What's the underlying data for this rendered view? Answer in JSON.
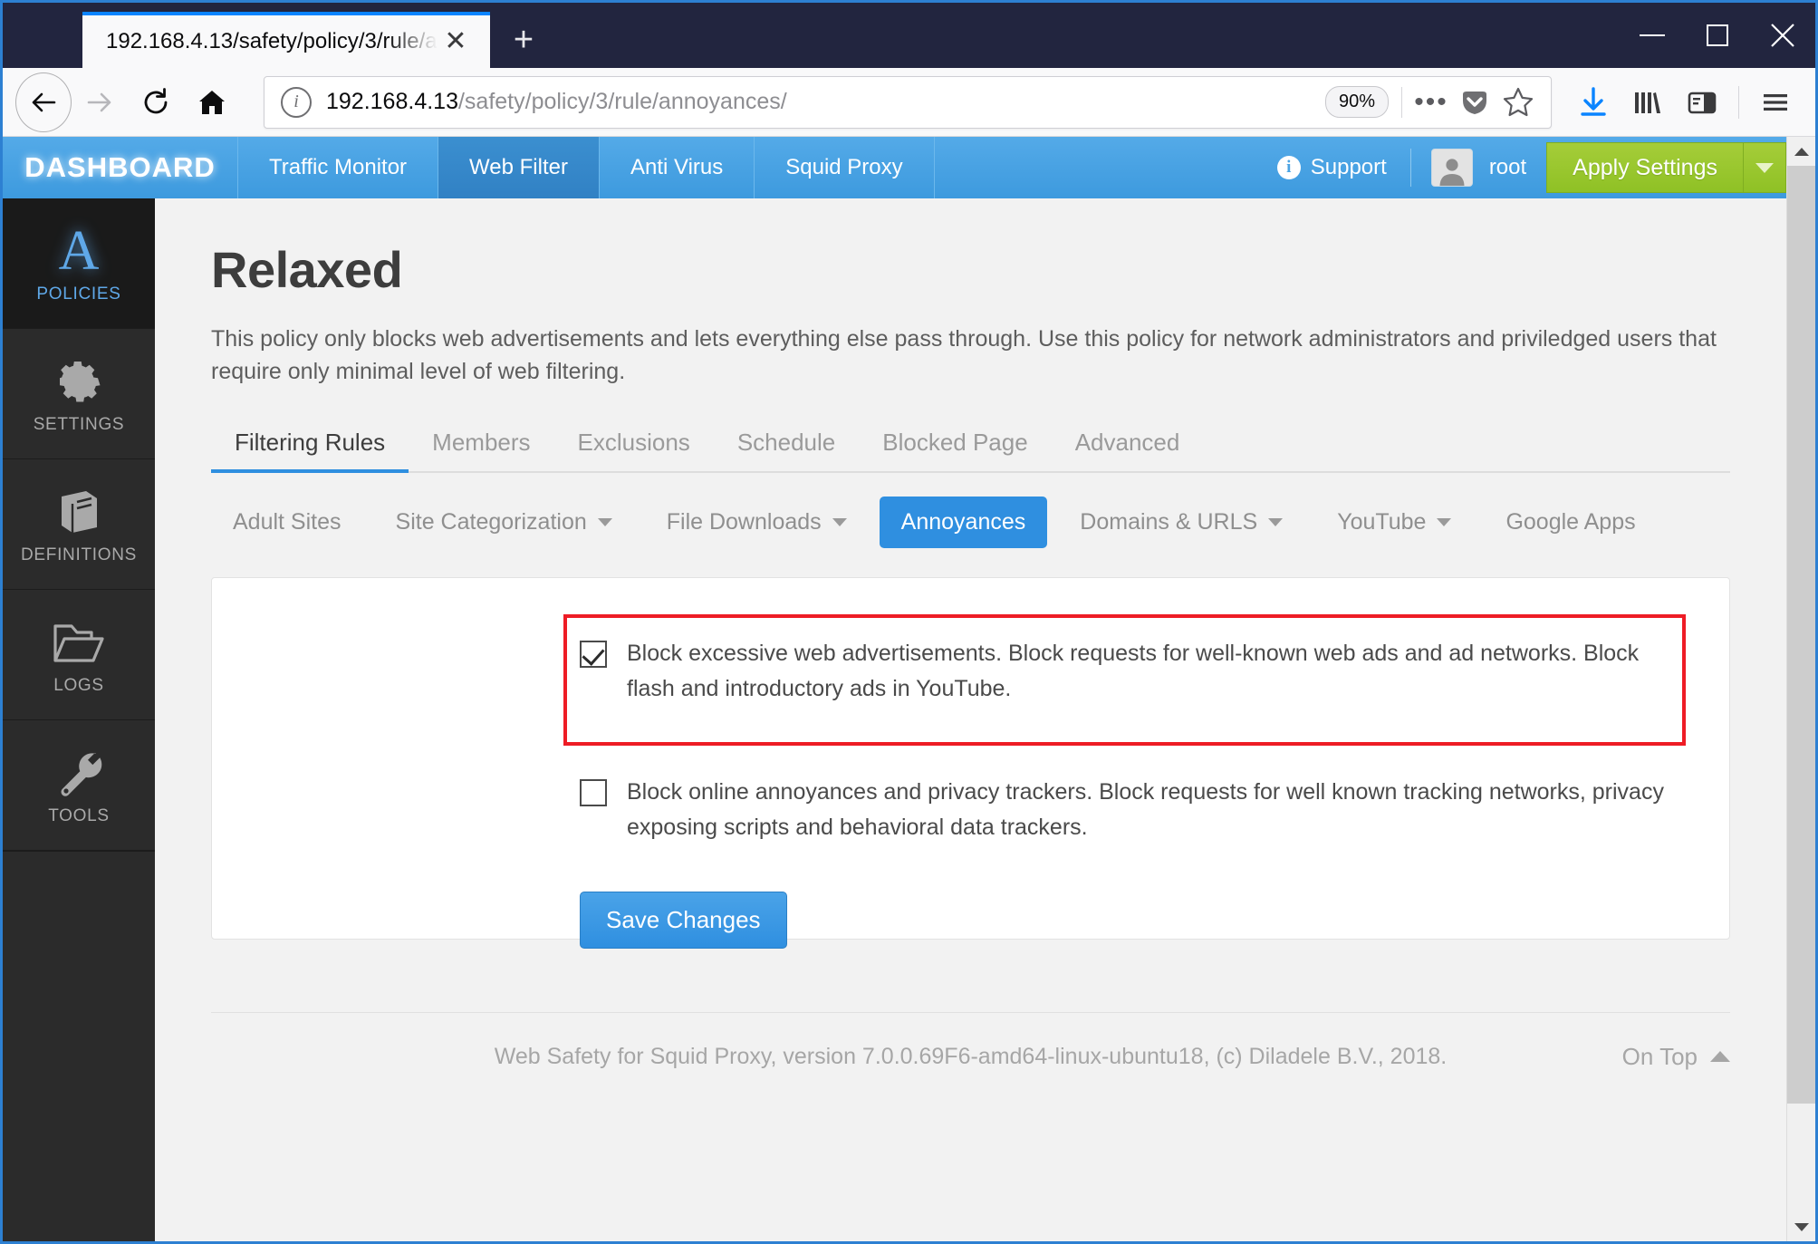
{
  "browser": {
    "tab": {
      "title": "192.168.4.13/safety/policy/3/rule/a",
      "close_label": "✕"
    },
    "new_tab_label": "+",
    "window_controls": {
      "minimize": "─",
      "maximize": "",
      "close": "✕"
    },
    "nav": {
      "back": "back-arrow",
      "forward": "forward-arrow",
      "reload": "reload",
      "home": "home"
    },
    "url": {
      "host": "192.168.4.13",
      "path": "/safety/policy/3/rule/annoyances/",
      "full": "192.168.4.13/safety/policy/3/rule/annoyances/",
      "zoom": "90%",
      "info_icon": "i"
    },
    "toolbar_icons": [
      "page-actions-icon",
      "pocket-icon",
      "bookmark-star-icon",
      "download-icon",
      "library-icon",
      "sidebar-icon",
      "menu-icon"
    ]
  },
  "appnav": {
    "brand": "DASHBOARD",
    "items": [
      {
        "label": "Traffic Monitor",
        "active": false
      },
      {
        "label": "Web Filter",
        "active": true
      },
      {
        "label": "Anti Virus",
        "active": false
      },
      {
        "label": "Squid Proxy",
        "active": false
      }
    ],
    "support_label": "Support",
    "user": "root",
    "apply_label": "Apply Settings"
  },
  "sidebar": {
    "items": [
      {
        "label": "POLICIES",
        "icon": "letter-a-icon",
        "active": true
      },
      {
        "label": "SETTINGS",
        "icon": "gear-icon",
        "active": false
      },
      {
        "label": "DEFINITIONS",
        "icon": "book-icon",
        "active": false
      },
      {
        "label": "LOGS",
        "icon": "folder-icon",
        "active": false
      },
      {
        "label": "TOOLS",
        "icon": "wrench-icon",
        "active": false
      }
    ]
  },
  "main": {
    "title": "Relaxed",
    "description": "This policy only blocks web advertisements and lets everything else pass through. Use this policy for network administrators and priviledged users that require only minimal level of web filtering.",
    "tabs": [
      {
        "label": "Filtering Rules",
        "active": true
      },
      {
        "label": "Members",
        "active": false
      },
      {
        "label": "Exclusions",
        "active": false
      },
      {
        "label": "Schedule",
        "active": false
      },
      {
        "label": "Blocked Page",
        "active": false
      },
      {
        "label": "Advanced",
        "active": false
      }
    ],
    "pills": [
      {
        "label": "Adult Sites",
        "active": false,
        "caret": false
      },
      {
        "label": "Site Categorization",
        "active": false,
        "caret": true
      },
      {
        "label": "File Downloads",
        "active": false,
        "caret": true
      },
      {
        "label": "Annoyances",
        "active": true,
        "caret": false
      },
      {
        "label": "Domains & URLS",
        "active": false,
        "caret": true
      },
      {
        "label": "YouTube",
        "active": false,
        "caret": true
      },
      {
        "label": "Google Apps",
        "active": false,
        "caret": false
      }
    ],
    "options": [
      {
        "text": "Block excessive web advertisements. Block requests for well-known web ads and ad networks. Block flash and introductory ads in YouTube.",
        "checked": true,
        "highlighted": true
      },
      {
        "text": "Block online annoyances and privacy trackers. Block requests for well known tracking networks, privacy exposing scripts and behavioral data trackers.",
        "checked": false,
        "highlighted": false
      }
    ],
    "save_label": "Save Changes"
  },
  "footer": {
    "text": "Web Safety for Squid Proxy, version 7.0.0.69F6-amd64-linux-ubuntu18, (c) Diladele B.V., 2018.",
    "ontop_label": "On Top"
  },
  "colors": {
    "accent_blue": "#2f8fe0",
    "nav_blue": "#4aa3e3",
    "apply_green": "#9ac62f",
    "highlight_red": "#ee1c25",
    "sidebar_dark": "#2b2b2b"
  }
}
